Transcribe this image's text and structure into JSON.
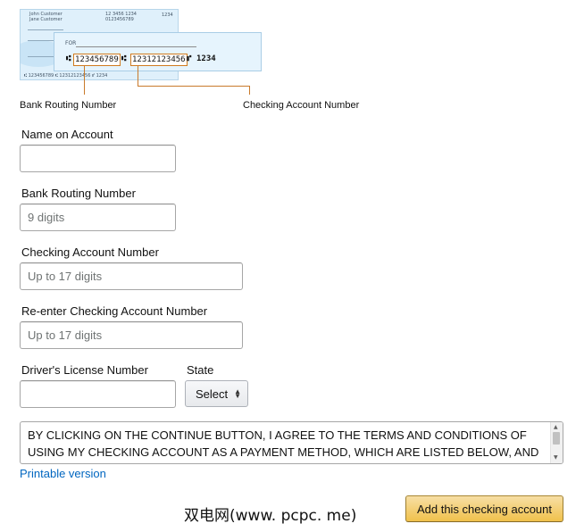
{
  "check_image": {
    "back_check": {
      "owner_line_1": "John Customer",
      "owner_line_2": "Jane Customer",
      "routing_top": "12 3456 1234",
      "account_top": "0123456789",
      "check_no_top": "1234",
      "micr_line": "⑆ 123456789 ⑆ 12312123456 ⑈ 1234"
    },
    "front_check": {
      "for_label": "FOR",
      "routing_number": "123456789",
      "account_number": "12312123456",
      "check_number": "1234"
    },
    "callouts": {
      "routing": "Bank Routing Number",
      "account": "Checking Account Number"
    }
  },
  "form": {
    "name_on_account": {
      "label": "Name on Account",
      "value": "",
      "placeholder": ""
    },
    "routing_number": {
      "label": "Bank Routing Number",
      "value": "",
      "placeholder": "9 digits"
    },
    "checking_account": {
      "label": "Checking Account Number",
      "value": "",
      "placeholder": "Up to 17 digits"
    },
    "reenter_checking": {
      "label": "Re-enter Checking Account Number",
      "value": "",
      "placeholder": "Up to 17 digits"
    },
    "drivers_license": {
      "label": "Driver's License Number",
      "value": "",
      "placeholder": ""
    },
    "state": {
      "label": "State",
      "selected": "Select"
    }
  },
  "terms": {
    "text": "BY CLICKING ON THE CONTINUE BUTTON, I AGREE TO THE TERMS AND CONDITIONS OF USING MY CHECKING ACCOUNT AS A PAYMENT METHOD, WHICH ARE LISTED BELOW, AND AUTHORIZE AMAZON.COM TO INITIATE ELECTRONIC FUNDS TRANSFERS FROM MY ACCOUNT."
  },
  "printable_link": "Printable version",
  "watermark": "双电网(www. pcpc. me)",
  "add_button": "Add this checking account"
}
